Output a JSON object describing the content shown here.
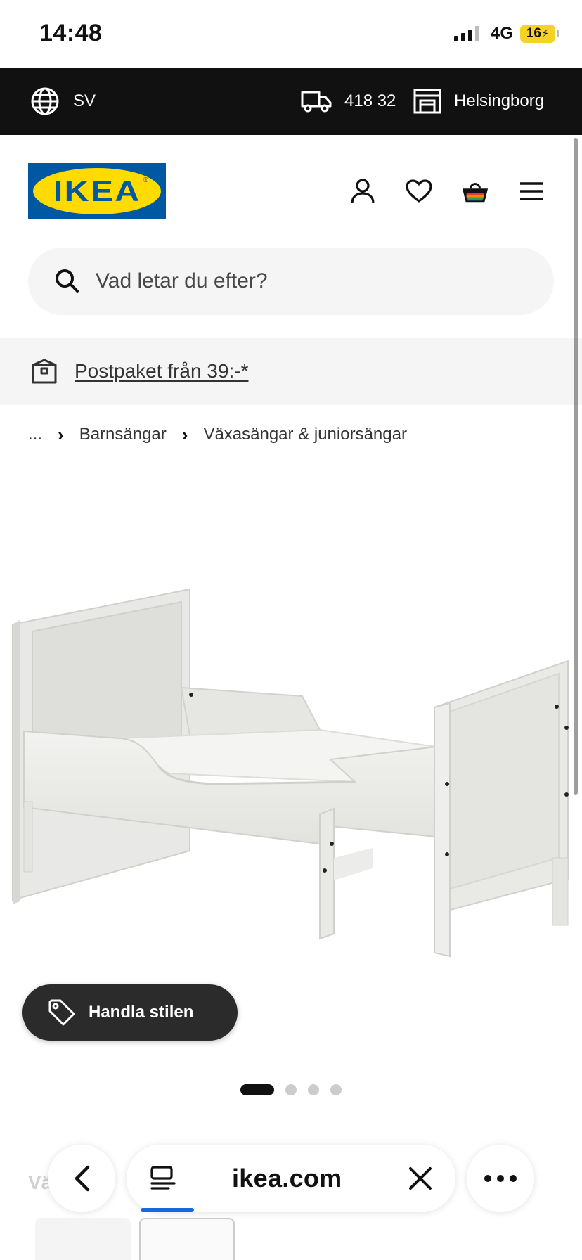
{
  "status_bar": {
    "time": "14:48",
    "network": "4G",
    "battery": "16"
  },
  "top_bar": {
    "language": "SV",
    "postcode": "418 32",
    "store": "Helsingborg"
  },
  "header": {
    "logo_text": "IKEA"
  },
  "search": {
    "placeholder": "Vad letar du efter?"
  },
  "promo": {
    "link": "Postpaket från 39:-*"
  },
  "breadcrumb": {
    "ellipsis": "...",
    "items": [
      "Barnsängar",
      "Växasängar & juniorsängar"
    ]
  },
  "product": {
    "image_icon": "extendable-bed-white-image"
  },
  "shop_look": {
    "label": "Handla stilen"
  },
  "carousel": {
    "total": 4,
    "active": 1
  },
  "below": {
    "title_partial": "Vä"
  },
  "browser": {
    "url": "ikea.com",
    "accent": "#1769e0"
  },
  "colors": {
    "ikea_blue": "#0058a3",
    "ikea_yellow": "#ffdb00",
    "top_bar_bg": "#111111"
  }
}
